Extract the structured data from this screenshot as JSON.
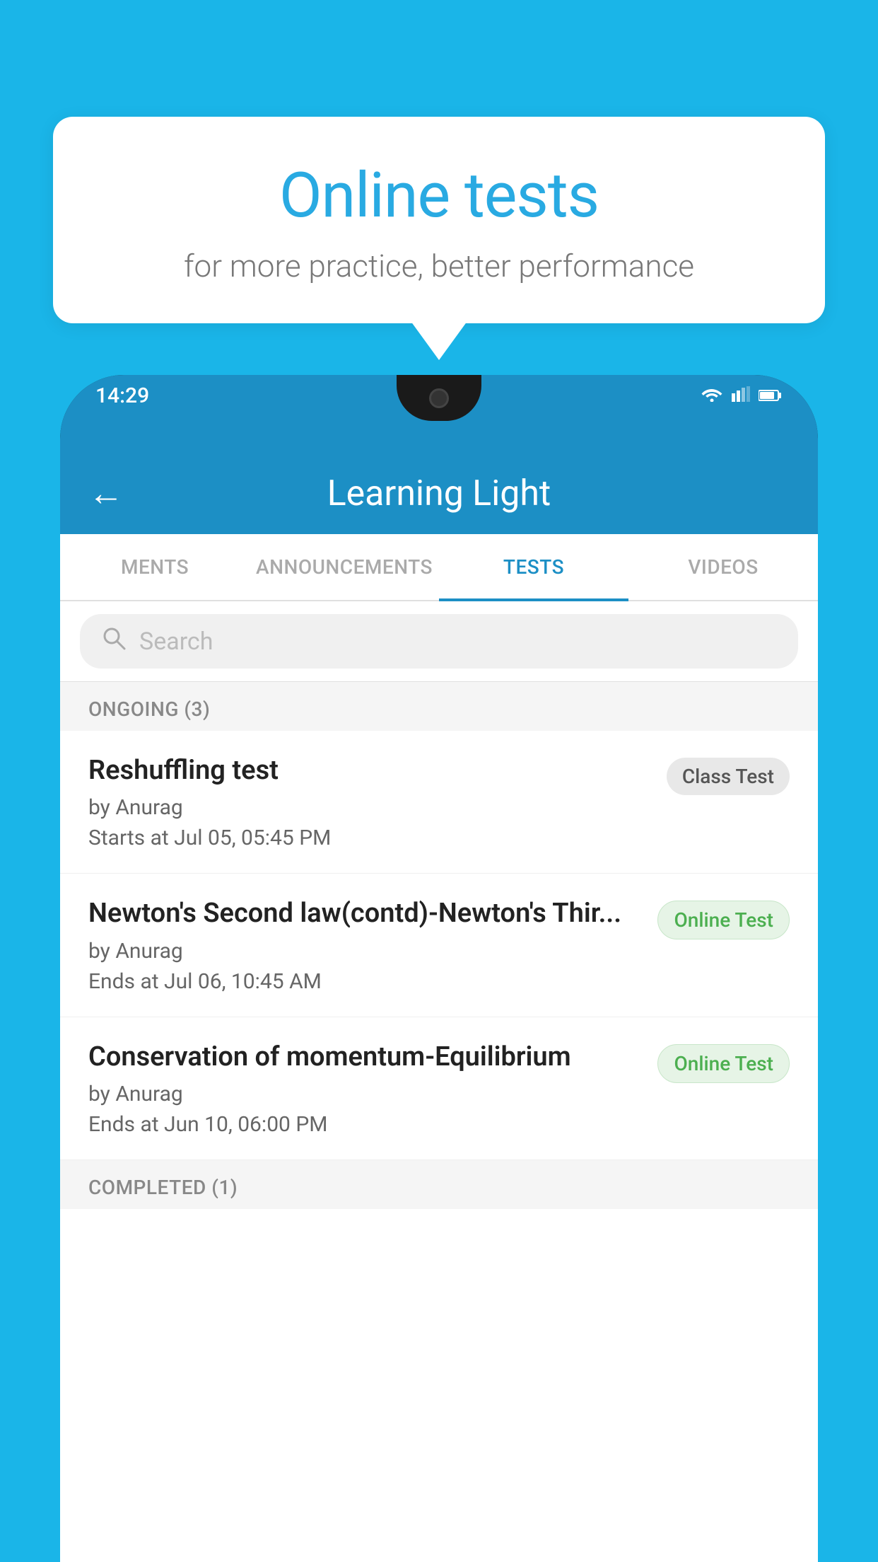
{
  "background": {
    "color": "#1ab5e8"
  },
  "speech_bubble": {
    "title": "Online tests",
    "subtitle": "for more practice, better performance"
  },
  "status_bar": {
    "time": "14:29",
    "icons": [
      "wifi",
      "signal",
      "battery"
    ]
  },
  "app_bar": {
    "title": "Learning Light",
    "back_label": "←"
  },
  "tabs": [
    {
      "label": "MENTS",
      "active": false
    },
    {
      "label": "ANNOUNCEMENTS",
      "active": false
    },
    {
      "label": "TESTS",
      "active": true
    },
    {
      "label": "VIDEOS",
      "active": false
    }
  ],
  "search": {
    "placeholder": "Search"
  },
  "sections": [
    {
      "header": "ONGOING (3)",
      "tests": [
        {
          "title": "Reshuffling test",
          "author": "by Anurag",
          "date": "Starts at  Jul 05, 05:45 PM",
          "badge": "Class Test",
          "badge_type": "class"
        },
        {
          "title": "Newton's Second law(contd)-Newton's Thir...",
          "author": "by Anurag",
          "date": "Ends at  Jul 06, 10:45 AM",
          "badge": "Online Test",
          "badge_type": "online"
        },
        {
          "title": "Conservation of momentum-Equilibrium",
          "author": "by Anurag",
          "date": "Ends at  Jun 10, 06:00 PM",
          "badge": "Online Test",
          "badge_type": "online"
        }
      ]
    },
    {
      "header": "COMPLETED (1)",
      "tests": []
    }
  ]
}
